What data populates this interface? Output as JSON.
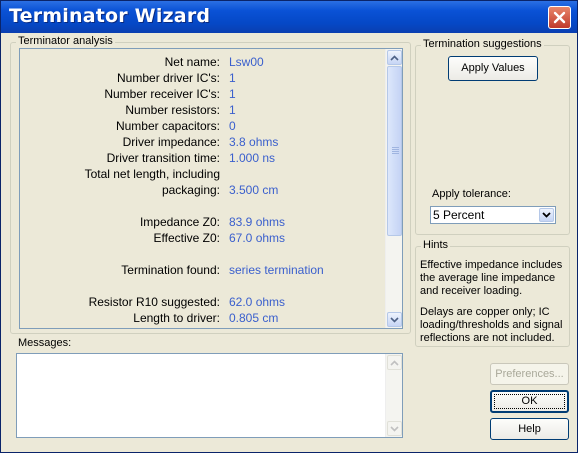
{
  "window": {
    "title": "Terminator Wizard"
  },
  "analysis": {
    "legend": "Terminator analysis",
    "rows": [
      {
        "label": "Net name:",
        "value": "Lsw00"
      },
      {
        "label": "Number driver IC's:",
        "value": "1"
      },
      {
        "label": "Number receiver IC's:",
        "value": "1"
      },
      {
        "label": "Number resistors:",
        "value": "1"
      },
      {
        "label": "Number capacitors:",
        "value": "0"
      },
      {
        "label": "Driver impedance:",
        "value": "3.8 ohms"
      },
      {
        "label": "Driver transition time:",
        "value": "1.000 ns"
      },
      {
        "label": "Total net length, including",
        "value": ""
      },
      {
        "label": "packaging:",
        "value": "3.500 cm"
      },
      {
        "label": "Impedance Z0:",
        "value": "83.9 ohms"
      },
      {
        "label": "Effective Z0:",
        "value": "67.0 ohms"
      },
      {
        "label": "Termination found:",
        "value": "series termination"
      },
      {
        "label": "Resistor R10 suggested:",
        "value": "62.0 ohms"
      },
      {
        "label": "Length to driver:",
        "value": "0.805 cm"
      }
    ]
  },
  "messages": {
    "legend": "Messages:",
    "content": ""
  },
  "suggestions": {
    "legend": "Termination suggestions",
    "apply_values_label": "Apply Values",
    "tolerance_label": "Apply tolerance:",
    "tolerance_selected": "5 Percent"
  },
  "hints": {
    "legend": "Hints",
    "text1": "Effective impedance includes the average line impedance and receiver loading.",
    "text2": "Delays are copper only; IC loading/thresholds and signal reflections are not  included."
  },
  "buttons": {
    "preferences_label": "Preferences...",
    "ok_label": "OK",
    "help_label": "Help"
  }
}
